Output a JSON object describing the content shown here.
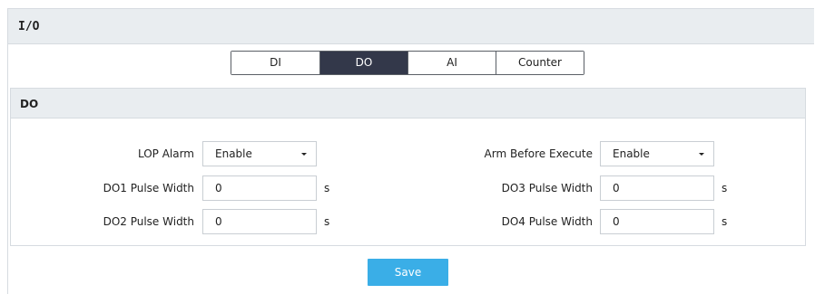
{
  "panel": {
    "title": "I/O"
  },
  "tabs": [
    {
      "label": "DI",
      "active": false
    },
    {
      "label": "DO",
      "active": true
    },
    {
      "label": "AI",
      "active": false
    },
    {
      "label": "Counter",
      "active": false
    }
  ],
  "section": {
    "title": "DO"
  },
  "form": {
    "lop_alarm": {
      "label": "LOP Alarm",
      "value": "Enable"
    },
    "arm_before_execute": {
      "label": "Arm Before Execute",
      "value": "Enable"
    },
    "do1_pulse_width": {
      "label": "DO1 Pulse Width",
      "value": "0",
      "unit": "s"
    },
    "do2_pulse_width": {
      "label": "DO2 Pulse Width",
      "value": "0",
      "unit": "s"
    },
    "do3_pulse_width": {
      "label": "DO3 Pulse Width",
      "value": "0",
      "unit": "s"
    },
    "do4_pulse_width": {
      "label": "DO4 Pulse Width",
      "value": "0",
      "unit": "s"
    }
  },
  "save_label": "Save",
  "colors": {
    "header_bg": "#e9edf0",
    "active_tab": "#33384a",
    "save_button": "#3aaee7"
  }
}
